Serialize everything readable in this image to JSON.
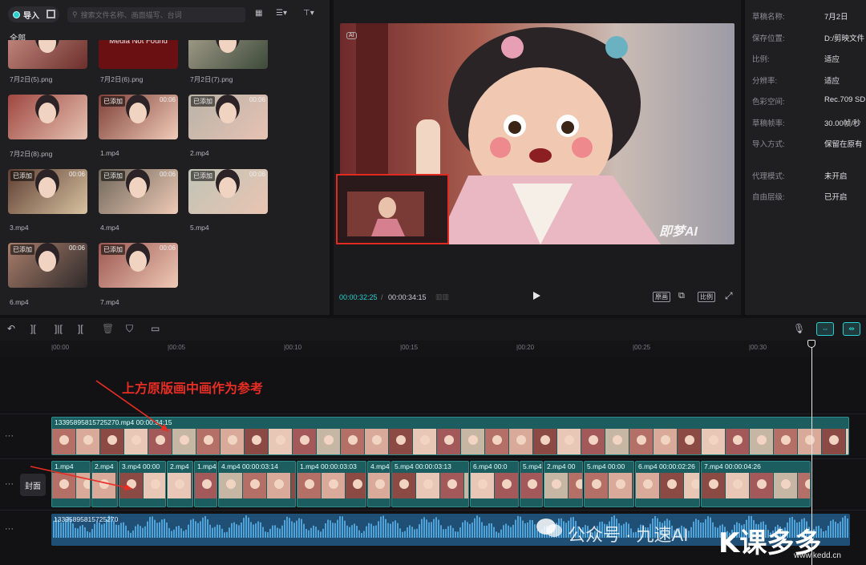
{
  "media": {
    "import_label": "导入",
    "search_placeholder": "搜索文件名称、画面描写、台词",
    "filter_all": "全部",
    "items": [
      {
        "name": "7月2日(5).png",
        "badge": "",
        "duration": ""
      },
      {
        "name": "7月2日(6).png",
        "badge": "",
        "duration": "",
        "overlay": "媒体丢失\nMedia Not Found"
      },
      {
        "name": "7月2日(7).png",
        "badge": "",
        "duration": ""
      },
      {
        "name": "7月2日(8).png",
        "badge": "",
        "duration": ""
      },
      {
        "name": "1.mp4",
        "badge": "已添加",
        "duration": "00:06"
      },
      {
        "name": "2.mp4",
        "badge": "已添加",
        "duration": "00:06"
      },
      {
        "name": "3.mp4",
        "badge": "已添加",
        "duration": "00:06"
      },
      {
        "name": "4.mp4",
        "badge": "已添加",
        "duration": "00:06"
      },
      {
        "name": "5.mp4",
        "badge": "已添加",
        "duration": "00:06"
      },
      {
        "name": "6.mp4",
        "badge": "已添加",
        "duration": "00:06"
      },
      {
        "name": "7.mp4",
        "badge": "已添加",
        "duration": "00:06"
      }
    ]
  },
  "player": {
    "ai_tag": "AI",
    "watermark": "即梦AI",
    "current_time": "00:00:32:25",
    "separator": "/",
    "total_time": "00:00:34:15",
    "buttons": {
      "original": "原画",
      "ratio": "比例"
    }
  },
  "properties": [
    {
      "label": "草稿名称:",
      "value": "7月2日"
    },
    {
      "label": "保存位置:",
      "value": "D:/剪映文件"
    },
    {
      "label": "比例:",
      "value": "适应"
    },
    {
      "label": "分辨率:",
      "value": "适应"
    },
    {
      "label": "色彩空间:",
      "value": "Rec.709 SD"
    },
    {
      "label": "草稿帧率:",
      "value": "30.00帧/秒"
    },
    {
      "label": "导入方式:",
      "value": "保留在原有"
    },
    {
      "label": "代理模式:",
      "value": "未开启"
    },
    {
      "label": "自由层级:",
      "value": "已开启"
    }
  ],
  "timeline": {
    "ruler_ticks": [
      "00:00",
      "00:05",
      "00:10",
      "00:15",
      "00:20",
      "00:25",
      "00:30"
    ],
    "annotation": "上方原版画中画作为参考",
    "cover_label": "封面",
    "track1_label": "13395895815725270.mp4   00:00:34:15",
    "track2_clips": [
      {
        "label": "1.mp4"
      },
      {
        "label": "2.mp4"
      },
      {
        "label": "3.mp4  00:00"
      },
      {
        "label": "2.mp4"
      },
      {
        "label": "1.mp4"
      },
      {
        "label": "4.mp4   00:00:03:14"
      },
      {
        "label": "1.mp4   00:00:03:03"
      },
      {
        "label": "4.mp4   00"
      },
      {
        "label": "5.mp4   00:00:03:13"
      },
      {
        "label": "6.mp4  00:0"
      },
      {
        "label": "5.mp4"
      },
      {
        "label": "2.mp4  00"
      },
      {
        "label": "5.mp4  00:00"
      },
      {
        "label": "6.mp4   00:00:02:26"
      },
      {
        "label": "7.mp4   00:00:04:26"
      }
    ],
    "audio_label": "13395895815725270",
    "wechat_watermark": "公众号 · 九速AI",
    "site_logo": "K课多多",
    "site_url": "www.kedd.cn"
  },
  "colors": {
    "accent": "#2ad0d0",
    "clip": "#1c5e5f",
    "audio": "#1f4f74",
    "annotation": "#e82d23"
  }
}
